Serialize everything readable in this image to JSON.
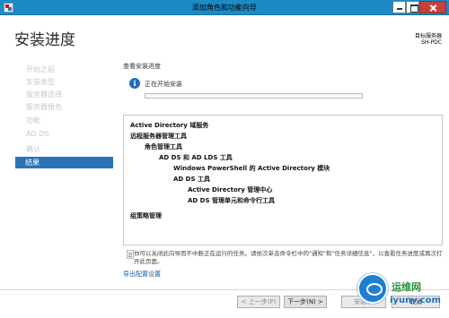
{
  "window": {
    "title": "添加角色和功能向导"
  },
  "header": {
    "page_title": "安装进度",
    "server_label": "目标服务器",
    "server_name": "SH-PDC"
  },
  "sidebar": {
    "items": [
      {
        "label": "开始之前"
      },
      {
        "label": "安装类型"
      },
      {
        "label": "服务器选择"
      },
      {
        "label": "服务器角色"
      },
      {
        "label": "功能"
      },
      {
        "label": "AD DS"
      },
      {
        "label": "确认"
      },
      {
        "label": "结果"
      }
    ]
  },
  "main": {
    "section_title": "查看安装进度",
    "status_text": "正在开始安装",
    "progress": 0,
    "log_items": [
      "Active Directory 域服务",
      "远程服务器管理工具",
      "角色管理工具",
      "AD DS 和 AD LDS 工具",
      "Windows PowerShell 的 Active Directory 模块",
      "AD DS 工具",
      "Active Directory 管理中心",
      "AD DS 管理单元和命令行工具",
      "组策略管理"
    ],
    "note": "你可以关闭此向导而不中断正在运行的任务。请依次单击命令栏中的\"通知\"和\"任务详细信息\"，以查看任务进度或再次打开此页面。",
    "export_link": "导出配置设置"
  },
  "footer": {
    "prev": "< 上一步(P)",
    "next": "下一步(N) >",
    "install": "安装(I)",
    "cancel": "取消"
  },
  "watermark": {
    "top": "运维网",
    "bottom": "iyunv.com"
  }
}
